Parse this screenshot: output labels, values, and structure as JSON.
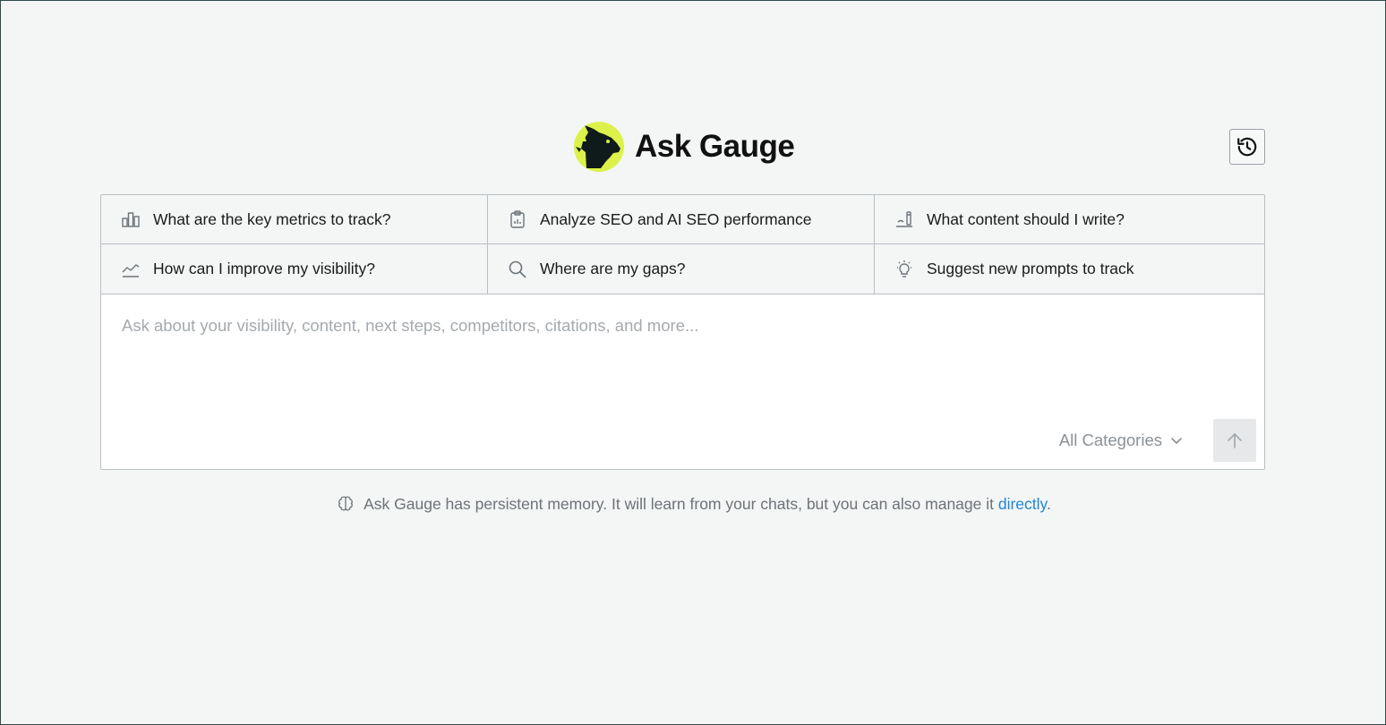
{
  "brand": {
    "title": "Ask Gauge",
    "logo_icon": "dog-head-logo-icon",
    "logo_bg": "#dcf24a"
  },
  "history_button": {
    "icon": "history-clock-icon"
  },
  "suggestions": [
    {
      "label": "What are the key metrics to track?",
      "icon": "bar-chart-icon"
    },
    {
      "label": "Analyze SEO and AI SEO performance",
      "icon": "clipboard-chart-icon"
    },
    {
      "label": "What content should I write?",
      "icon": "writing-icon"
    },
    {
      "label": "How can I improve my visibility?",
      "icon": "trend-line-icon"
    },
    {
      "label": "Where are my gaps?",
      "icon": "search-icon"
    },
    {
      "label": "Suggest new prompts to track",
      "icon": "lightbulb-icon"
    }
  ],
  "input": {
    "placeholder": "Ask about your visibility, content, next steps, competitors, citations, and more...",
    "value": ""
  },
  "category_select": {
    "selected": "All Categories",
    "icon": "chevron-down-icon"
  },
  "send_button": {
    "icon": "arrow-up-icon"
  },
  "footer": {
    "icon": "brain-icon",
    "text": "Ask Gauge has persistent memory. It will learn from your chats, but you can also manage it ",
    "link_text": "directly",
    "trailing": ".",
    "link_color": "#1d86d8"
  }
}
